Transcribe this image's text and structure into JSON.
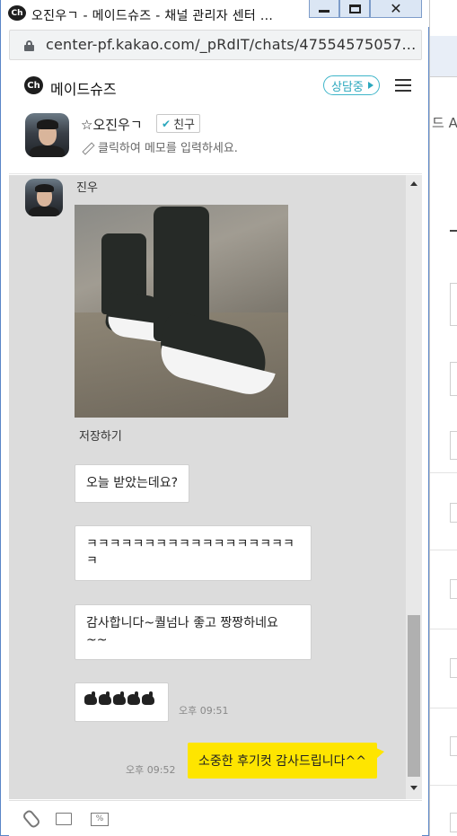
{
  "window": {
    "title": "오진우ㄱ - 메이드슈즈 - 채널 관리자 센터 ...",
    "ch_logo": "Ch"
  },
  "browser": {
    "url": "center-pf.kakao.com/_pRdIT/chats/47554575057..."
  },
  "background_window": {
    "partial_text": "드 AI"
  },
  "header": {
    "ch_logo": "Ch",
    "channel_name": "메이드슈즈",
    "status": "상담중",
    "friend_name": "☆오진우ㄱ",
    "friend_badge": "친구",
    "memo_placeholder": "클릭하여 메모를 입력하세요."
  },
  "chat": {
    "sender_name": "진우",
    "photo_save_label": "저장하기",
    "messages": [
      {
        "from": "customer",
        "text": "오늘 받았는데요?"
      },
      {
        "from": "customer",
        "text": "ㅋㅋㅋㅋㅋㅋㅋㅋㅋㅋㅋㅋㅋㅋㅋㅋㅋㅋ ㅋ"
      },
      {
        "from": "customer",
        "text": "감사합니다~퀄넘나 좋고 짱짱하네요 ~~"
      },
      {
        "from": "customer",
        "emoji": "thumbs-up x5",
        "time": "오후 09:51"
      },
      {
        "from": "agent",
        "text": "소중한 후기컷 감사드립니다^^",
        "time": "오후 09:52"
      }
    ]
  },
  "colors": {
    "agent_bubble": "#fee500",
    "status_accent": "#2aa7bd",
    "chat_background": "#dcdcdc"
  }
}
